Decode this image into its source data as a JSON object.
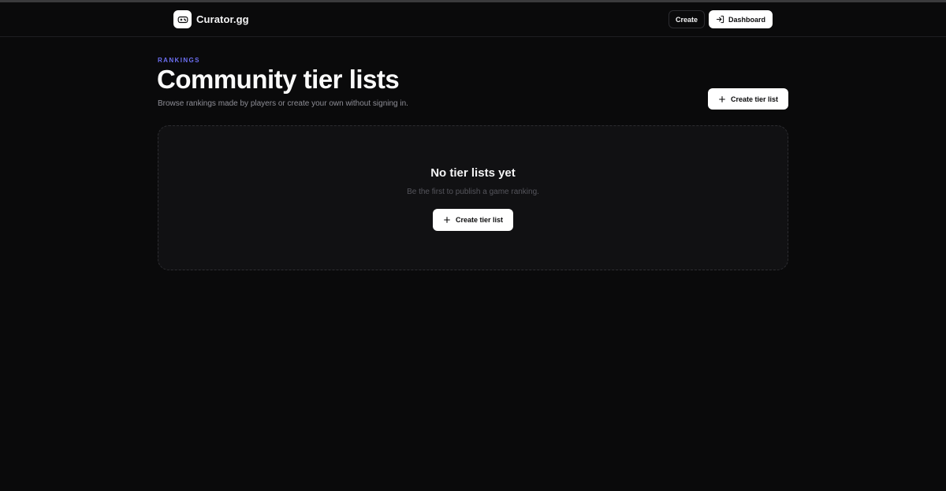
{
  "header": {
    "brand_name": "Curator.gg",
    "brand_icon": "gamepad-icon",
    "nav": {
      "create_label": "Create",
      "dashboard_label": "Dashboard",
      "dashboard_icon": "sign-in-icon"
    }
  },
  "hero": {
    "eyebrow": "RANKINGS",
    "title": "Community tier lists",
    "subtitle": "Browse rankings made by players or create your own without signing in.",
    "create_button_label": "Create tier list",
    "create_button_icon": "plus-icon"
  },
  "empty_state": {
    "title": "No tier lists yet",
    "text": "Be the first to publish a game ranking.",
    "button_label": "Create tier list",
    "button_icon": "plus-icon"
  },
  "colors": {
    "background": "#0a0a0b",
    "card": "#111113",
    "accent": "#6c6ff2",
    "primary_button": "#ffffff"
  }
}
